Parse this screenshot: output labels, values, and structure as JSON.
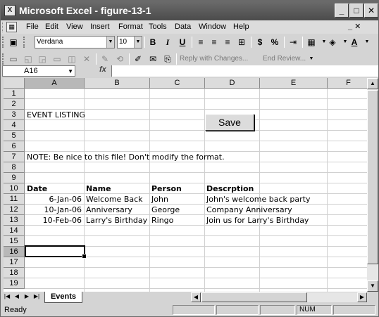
{
  "window": {
    "title": "Microsoft Excel - figure-13-1",
    "minimize": "_",
    "maximize": "□",
    "close": "✕"
  },
  "menu": {
    "items": [
      "File",
      "Edit",
      "View",
      "Insert",
      "Format",
      "Tools",
      "Data",
      "Window",
      "Help"
    ],
    "doc_controls": "_ ✕"
  },
  "formatting_toolbar": {
    "font_name": "Verdana",
    "font_size": "10",
    "bold": "B",
    "italic": "I",
    "underline": "U",
    "currency": "$",
    "percent": "%",
    "font_color": "A"
  },
  "reviewing_toolbar": {
    "reply_with_changes": "Reply with Changes...",
    "end_review": "End Review..."
  },
  "formula_bar": {
    "name_box": "A16",
    "fx": "fx",
    "formula": ""
  },
  "grid": {
    "columns": [
      "A",
      "B",
      "C",
      "D",
      "E",
      "F"
    ],
    "rows": [
      "1",
      "2",
      "3",
      "4",
      "5",
      "6",
      "7",
      "8",
      "9",
      "10",
      "11",
      "12",
      "13",
      "14",
      "15",
      "16",
      "17",
      "18",
      "19"
    ],
    "selected_column": "A",
    "selected_row": "16",
    "event_listing": "EVENT LISTING",
    "note": "NOTE: Be nice to this file!  Don't modify the format.",
    "headers": {
      "date": "Date",
      "name": "Name",
      "person": "Person",
      "description": "Descrption"
    },
    "records": [
      {
        "date": "6-Jan-06",
        "name": "Welcome Back",
        "person": "John",
        "description": "John's welcome back party"
      },
      {
        "date": "10-Jan-06",
        "name": "Anniversary",
        "person": "George",
        "description": "Company Anniversary"
      },
      {
        "date": "10-Feb-06",
        "name": "Larry's Birthday",
        "person": "Ringo",
        "description": "Join us for Larry's Birthday"
      }
    ]
  },
  "save_button": "Save",
  "sheet_tab": "Events",
  "status": {
    "text": "Ready",
    "num": "NUM"
  }
}
